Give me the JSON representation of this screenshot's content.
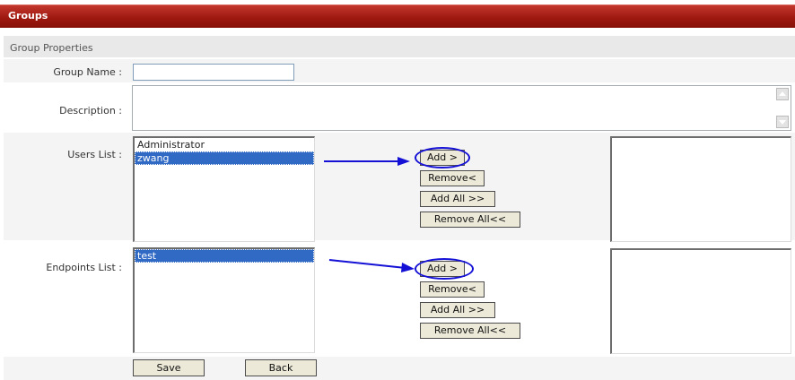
{
  "header": {
    "title": "Groups"
  },
  "section": {
    "title": "Group Properties"
  },
  "form": {
    "group_name_label": "Group Name :",
    "group_name_value": "",
    "description_label": "Description :",
    "users_label": "Users List :",
    "endpoints_label": "Endpoints List :"
  },
  "users": {
    "available": [
      {
        "name": "Administrator",
        "selected": false
      },
      {
        "name": "zwang",
        "selected": true
      }
    ],
    "assigned": [],
    "buttons": {
      "add": "Add >",
      "remove": "Remove<",
      "add_all": "Add All >>",
      "remove_all": "Remove All<<"
    }
  },
  "endpoints": {
    "available": [
      {
        "name": "test",
        "selected": true
      }
    ],
    "assigned": [],
    "buttons": {
      "add": "Add >",
      "remove": "Remove<",
      "add_all": "Add All >>",
      "remove_all": "Remove All<<"
    }
  },
  "actions": {
    "save": "Save",
    "back": "Back"
  },
  "colors": {
    "header_red": "#9f1910",
    "selection_blue": "#316ac5",
    "annotation_blue": "#1410d6"
  }
}
